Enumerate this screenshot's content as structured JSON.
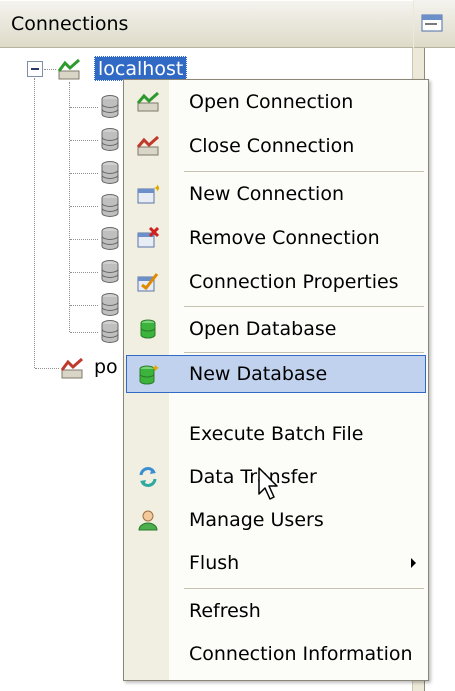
{
  "panel": {
    "title": "Connections"
  },
  "tree": {
    "localhost_label": "localhost",
    "po_label": "po"
  },
  "menu": {
    "items": [
      {
        "label": "Open Connection",
        "icon": "open-connection-icon"
      },
      {
        "label": "Close Connection",
        "icon": "close-connection-icon"
      },
      {
        "label": "New Connection",
        "icon": "new-connection-icon"
      },
      {
        "label": "Remove Connection",
        "icon": "remove-connection-icon"
      },
      {
        "label": "Connection Properties",
        "icon": "connection-properties-icon"
      },
      {
        "label": "Open Database",
        "icon": "open-database-icon"
      },
      {
        "label": "New Database",
        "icon": "new-database-icon",
        "highlighted": true
      },
      {
        "label": "Execute Batch File",
        "icon": ""
      },
      {
        "label": "Data Transfer",
        "icon": "data-transfer-icon"
      },
      {
        "label": "Manage Users",
        "icon": "manage-users-icon"
      },
      {
        "label": "Flush",
        "icon": "",
        "submenu": true
      },
      {
        "label": "Refresh",
        "icon": ""
      },
      {
        "label": "Connection Information",
        "icon": ""
      }
    ]
  },
  "colors": {
    "selection": "#316ac5",
    "menu_highlight": "#c1d2ee"
  }
}
